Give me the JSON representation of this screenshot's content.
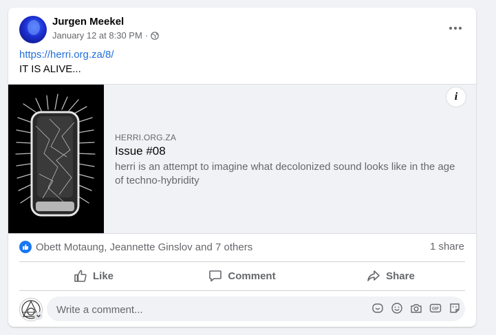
{
  "post": {
    "author": "Jurgen Meekel",
    "timestamp": "January 12 at 8:30 PM",
    "separator": "·",
    "audience_icon": "globe-icon",
    "link_text": "https://herri.org.za/8/",
    "body_text": "IT IS ALIVE..."
  },
  "preview": {
    "domain": "HERRI.ORG.ZA",
    "title": "Issue #08",
    "description": "herri is an attempt to imagine what decolonized sound looks like in the age of techno-hybridity",
    "info_icon": "i"
  },
  "reactions": {
    "names": "Obett Motaung, Jeannette Ginslov and 7 others",
    "shares": "1 share"
  },
  "actions": {
    "like": "Like",
    "comment": "Comment",
    "share": "Share"
  },
  "composer": {
    "placeholder": "Write a comment...",
    "gif_label": "GIF"
  },
  "colors": {
    "link": "#216fdb",
    "like_blue": "#1877f2",
    "secondary_text": "#65676b"
  }
}
